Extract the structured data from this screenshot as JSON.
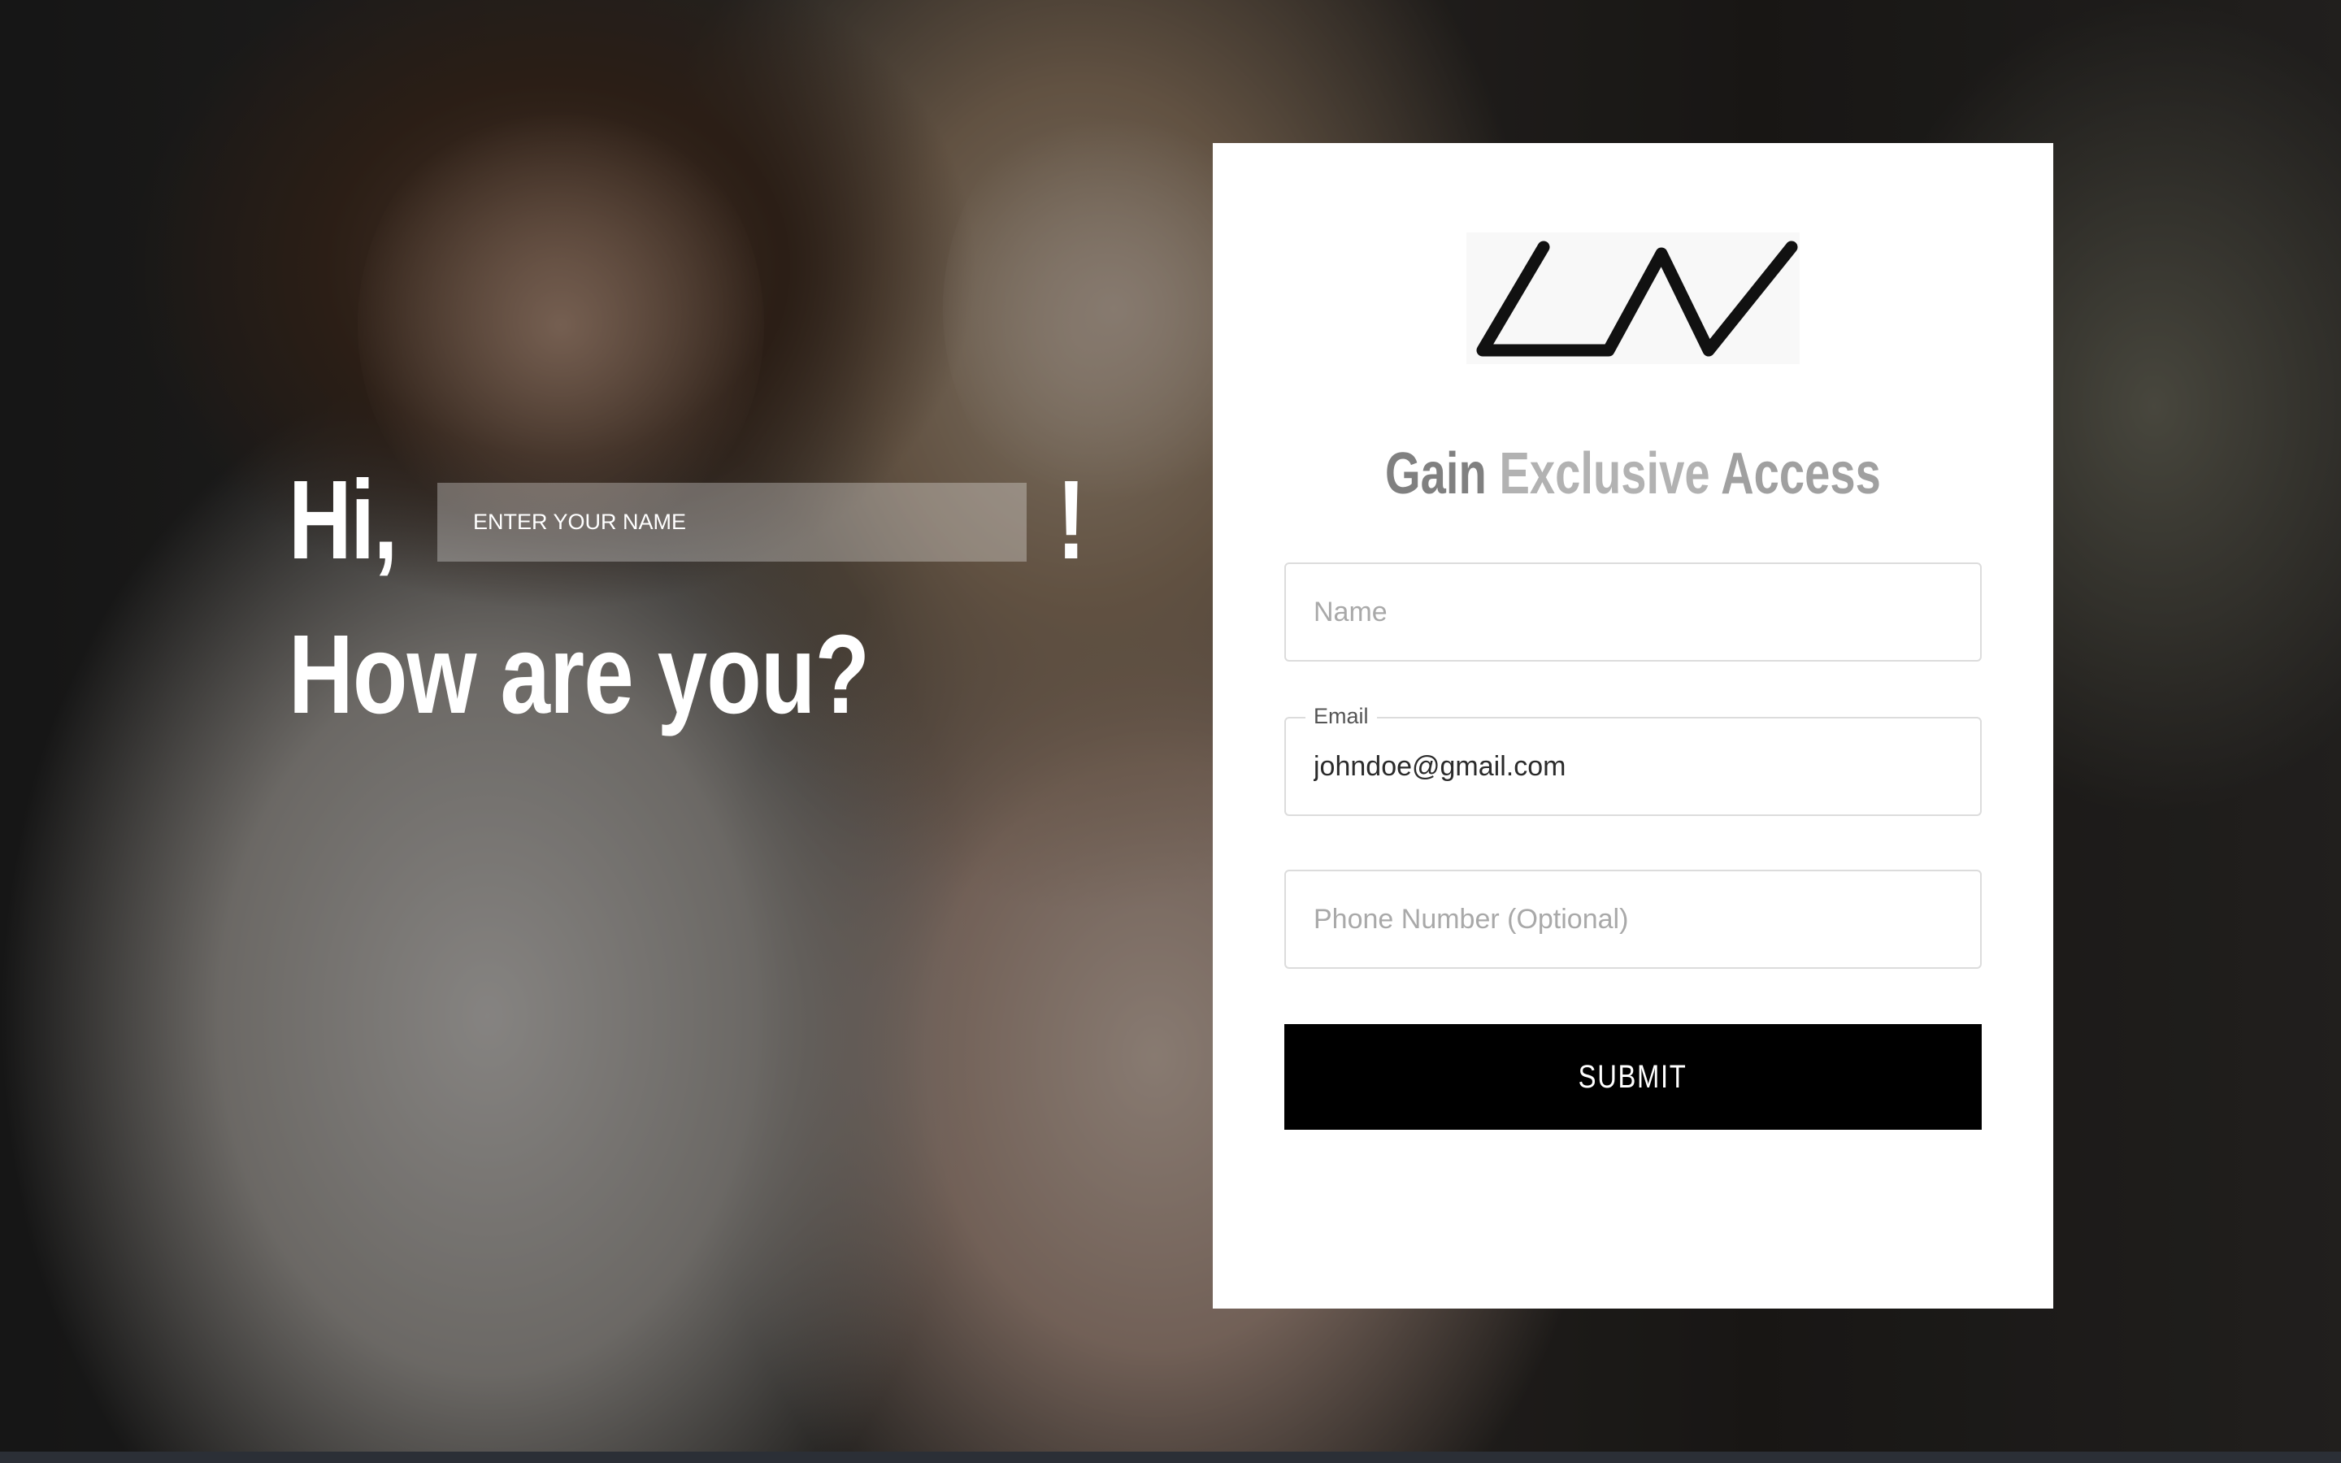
{
  "greeting": {
    "hi_text": "Hi,",
    "name_placeholder": "ENTER YOUR NAME",
    "exclaim": "!",
    "line2": "How are you?"
  },
  "card": {
    "logo_icon": "ln-brand-logo-icon",
    "title": {
      "part1": "Gain ",
      "part2": "Exclusive ",
      "part3": "Access"
    },
    "fields": {
      "name": {
        "placeholder": "Name",
        "value": ""
      },
      "email": {
        "label": "Email",
        "value": "johndoe@gmail.com"
      },
      "phone": {
        "placeholder": "Phone Number (Optional)",
        "value": ""
      }
    },
    "submit_label": "SUBMIT"
  },
  "colors": {
    "card_bg": "#ffffff",
    "button_bg": "#000000",
    "title_dark": "#808080",
    "title_light": "#b2b2b2"
  }
}
